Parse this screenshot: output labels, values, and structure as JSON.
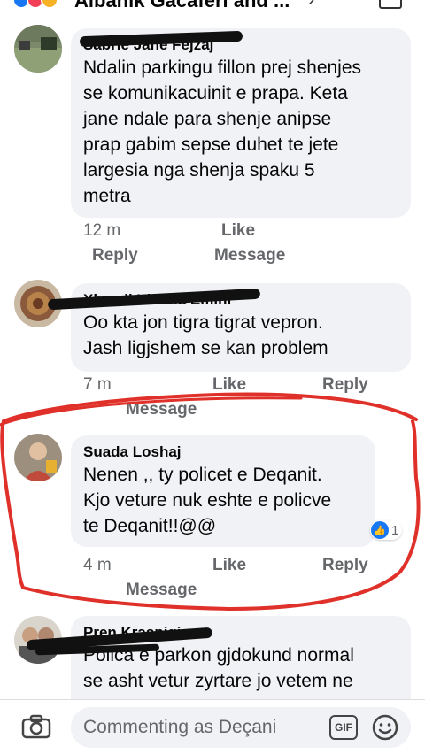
{
  "header": {
    "title": "Albanik Gacaferi and ...",
    "reaction_colors": [
      "#1877f2",
      "#f33e58",
      "#f7b125"
    ]
  },
  "comments": [
    {
      "author": "Sabrie Jane Fejzaj",
      "text_lines": [
        "Ndalin parkingu fillon prej shenjes",
        "se komunikacuinit e prapa. Keta",
        "jane ndale para shenje anipse",
        "prap gabim sepse duhet te jete",
        "largesia nga shenja spaku 5",
        "metra"
      ],
      "time": "12 m",
      "like": "Like",
      "reply": "Reply",
      "message": "Message"
    },
    {
      "author": "Xhevdi Xhema Emini",
      "text_lines": [
        "Oo kta jon tigra tigrat vepron.",
        "Jash ligjshem se kan problem"
      ],
      "time": "7 m",
      "like": "Like",
      "reply": "Reply",
      "message": "Message"
    },
    {
      "author": "Suada Loshaj",
      "text_lines": [
        "Nenen ,,  ty policet e Deqanit.",
        "Kjo veture nuk eshte e policve",
        "te Deqanit!!@@"
      ],
      "time": "4 m",
      "like": "Like",
      "reply": "Reply",
      "message": "Message",
      "reaction_count": "1"
    },
    {
      "author": "Pren Krasniqi",
      "text_lines": [
        "Polica e parkon gjdokund normal",
        "se asht vetur zyrtare jo vetem ne"
      ]
    }
  ],
  "composer": {
    "placeholder": "Commenting as Deçani",
    "gif_label": "GIF",
    "camera_icon": "camera-icon",
    "emoji_icon": "emoji-icon"
  },
  "colors": {
    "bubble": "#f0f2f5",
    "meta_text": "#65676b",
    "like_blue": "#1877f2",
    "annotation_red": "#e0302a"
  }
}
